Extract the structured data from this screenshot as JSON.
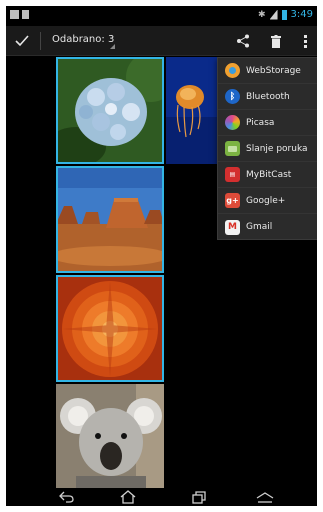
{
  "status_bar": {
    "time": "3:49",
    "icons": [
      "gallery-icon",
      "sd-card-icon",
      "bluetooth-icon",
      "signal-icon",
      "battery-icon"
    ],
    "accent_color": "#33b5e5"
  },
  "action_bar": {
    "selection_label": "Odabrano: 3",
    "icons": [
      "checkmark-icon",
      "share-icon",
      "trash-icon",
      "overflow-menu-icon"
    ]
  },
  "photos": [
    {
      "name": "hydrangea",
      "selected": true
    },
    {
      "name": "jellyfish",
      "selected": false
    },
    {
      "name": "desert",
      "selected": true
    },
    {
      "name": "chrysanthemum",
      "selected": true
    },
    {
      "name": "koala",
      "selected": false
    }
  ],
  "share_menu": {
    "items": [
      {
        "label": "WebStorage",
        "icon": "webstorage-icon",
        "color": "#f0a030"
      },
      {
        "label": "Bluetooth",
        "icon": "bluetooth-icon",
        "color": "#1e66c8"
      },
      {
        "label": "Picasa",
        "icon": "picasa-icon",
        "color": "#e04a8a"
      },
      {
        "label": "Slanje poruka",
        "icon": "messaging-icon",
        "color": "#7cb342"
      },
      {
        "label": "MyBitCast",
        "icon": "mybitcast-icon",
        "color": "#d32f2f"
      },
      {
        "label": "Google+",
        "icon": "google-plus-icon",
        "color": "#dd4b39"
      },
      {
        "label": "Gmail",
        "icon": "gmail-icon",
        "color": "#e8e8e8"
      }
    ]
  },
  "nav_bar": {
    "icons": [
      "back-icon",
      "home-icon",
      "recent-apps-icon",
      "menu-icon"
    ]
  }
}
